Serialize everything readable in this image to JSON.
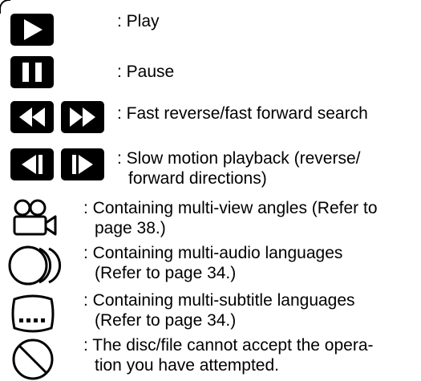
{
  "legend": [
    {
      "icon": "play-icon",
      "lines": [
        ": Play"
      ]
    },
    {
      "icon": "pause-icon",
      "lines": [
        ": Pause"
      ]
    },
    {
      "icon": "fast-reverse-forward-icon",
      "lines": [
        ": Fast reverse/fast forward search"
      ]
    },
    {
      "icon": "slow-motion-icon",
      "lines": [
        ": Slow motion playback (reverse/",
        "forward directions)"
      ]
    },
    {
      "icon": "camera-angle-icon",
      "lines": [
        ": Containing multi-view angles (Refer to",
        "page 38.)"
      ]
    },
    {
      "icon": "audio-languages-icon",
      "lines": [
        ": Containing multi-audio languages",
        "(Refer to page 34.)"
      ]
    },
    {
      "icon": "subtitle-languages-icon",
      "lines": [
        ": Containing multi-subtitle languages",
        "(Refer to page 34.)"
      ]
    },
    {
      "icon": "prohibited-icon",
      "lines": [
        ": The disc/file cannot accept the opera-",
        "tion you have attempted."
      ]
    }
  ]
}
